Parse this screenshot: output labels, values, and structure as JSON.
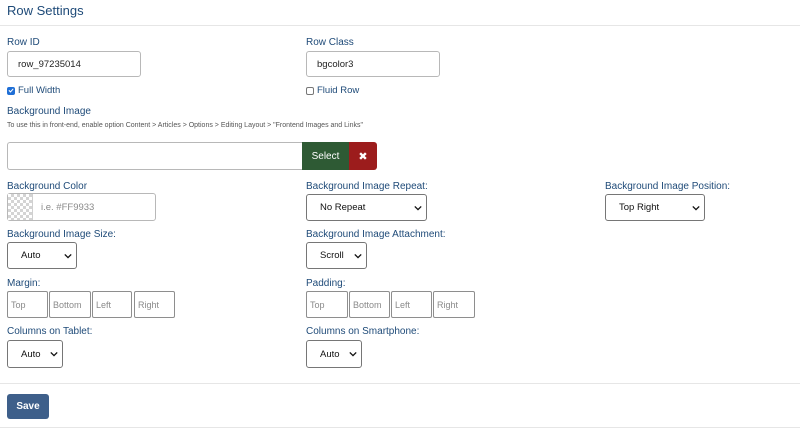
{
  "header": {
    "title": "Row Settings"
  },
  "row_id": {
    "label": "Row ID",
    "value": "row_97235014"
  },
  "row_class": {
    "label": "Row Class",
    "value": "bgcolor3"
  },
  "full_width": {
    "label": "Full Width",
    "checked": true
  },
  "fluid_row": {
    "label": "Fluid Row",
    "checked": false
  },
  "background_image": {
    "label": "Background Image",
    "help": "To use this in front-end, enable option Content > Articles > Options > Editing Layout > \"Frontend Images and Links\"",
    "value": "",
    "select_label": "Select",
    "clear_label": "✖"
  },
  "background_color": {
    "label": "Background Color",
    "placeholder": "i.e. #FF9933"
  },
  "background_image_repeat": {
    "label": "Background Image Repeat:",
    "value": "No Repeat"
  },
  "background_image_position": {
    "label": "Background Image Position:",
    "value": "Top Right"
  },
  "background_image_size": {
    "label": "Background Image Size:",
    "value": "Auto"
  },
  "background_image_attachment": {
    "label": "Background Image Attachment:",
    "value": "Scroll"
  },
  "margin": {
    "label": "Margin:",
    "top": "Top",
    "bottom": "Bottom",
    "left": "Left",
    "right": "Right"
  },
  "padding": {
    "label": "Padding:",
    "top": "Top",
    "bottom": "Bottom",
    "left": "Left",
    "right": "Right"
  },
  "columns_tablet": {
    "label": "Columns on Tablet:",
    "value": "Auto"
  },
  "columns_smartphone": {
    "label": "Columns on Smartphone:",
    "value": "Auto"
  },
  "footer": {
    "save_label": "Save"
  },
  "colors": {
    "label": "#1e4a78",
    "select_button": "#2e5a34",
    "clear_button": "#9c1c1c",
    "save_button": "#3e5f8a",
    "checkbox": "#1f6fd6"
  }
}
